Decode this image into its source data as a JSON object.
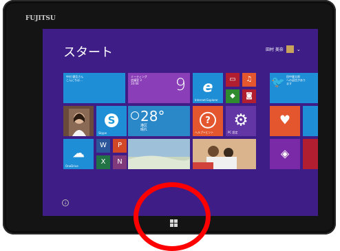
{
  "brand": "FUJITSU",
  "start": {
    "title": "スタート",
    "user_name": "田村 美奈",
    "user_caret": "⌄"
  },
  "tiles": {
    "contact": {
      "text": "中村 健吾さん\nこんにちは…",
      "label": ""
    },
    "calendar": {
      "text": "ミーティング\n会議室 3\n10:00",
      "number": "9",
      "label": ""
    },
    "ie": {
      "label": "Internet Explorer"
    },
    "mail": {
      "label": ""
    },
    "twitter": {
      "text": "田中健太郎\nへの返信があり\nます",
      "label": ""
    },
    "people_photo": {
      "label": ""
    },
    "skype": {
      "label": "Skype"
    },
    "weather": {
      "temp": "28°",
      "city": "港区",
      "cond": "晴れ",
      "label": ""
    },
    "help": {
      "label": "ヘルプ+ヒント"
    },
    "settings": {
      "label": "PC 設定"
    },
    "health": {
      "label": ""
    },
    "onedrive": {
      "label": "OneDrive"
    },
    "news": {
      "label": ""
    },
    "photos": {
      "label": ""
    },
    "store": {
      "label": ""
    },
    "food": {
      "label": ""
    }
  },
  "colors": {
    "screen_bg": "#3e1e86",
    "accent_blue": "#1e8fd6",
    "purple_tile": "#6336a6",
    "orange": "#e4572e",
    "red_ring": "#ff0000"
  },
  "icons": [
    "skype-icon",
    "ie-icon",
    "gear-icon",
    "help-icon",
    "onedrive-icon",
    "twitter-icon",
    "health-icon",
    "windows-logo-icon",
    "down-arrow-icon"
  ]
}
